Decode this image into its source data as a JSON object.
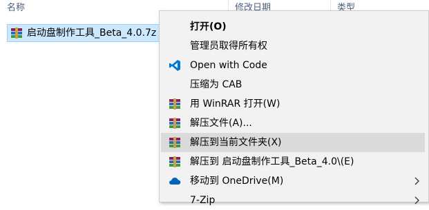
{
  "explorer": {
    "columns": {
      "name": "名称",
      "date": "修改日期",
      "type": "类型"
    },
    "selected_file": {
      "name": "启动盘制作工具_Beta_4.0.7z",
      "icon": "winrar-archive-icon"
    }
  },
  "context_menu": {
    "items": [
      {
        "label": "打开(O)",
        "bold": true,
        "icon": ""
      },
      {
        "label": "管理员取得所有权",
        "icon": ""
      },
      {
        "label": "Open with Code",
        "icon": "vscode-icon"
      },
      {
        "label": "压缩为 CAB",
        "icon": ""
      },
      {
        "label": "用 WinRAR 打开(W)",
        "icon": "winrar-icon"
      },
      {
        "label": "解压文件(A)...",
        "icon": "winrar-icon"
      },
      {
        "label": "解压到当前文件夹(X)",
        "icon": "winrar-icon",
        "highlighted": true
      },
      {
        "label": "解压到 启动盘制作工具_Beta_4.0\\(E)",
        "icon": "winrar-icon"
      },
      {
        "label": "移动到 OneDrive(M)",
        "icon": "onedrive-icon",
        "submenu": true
      },
      {
        "label": "7-Zip",
        "icon": "",
        "submenu": true
      }
    ]
  },
  "colors": {
    "selection_bg": "#cce8ff",
    "selection_border": "#99d1ff",
    "menu_bg": "#f2f2f2",
    "menu_hover": "#dadada",
    "header_text": "#4c607a",
    "vscode_blue": "#0078d4",
    "onedrive_blue": "#0364b8"
  }
}
